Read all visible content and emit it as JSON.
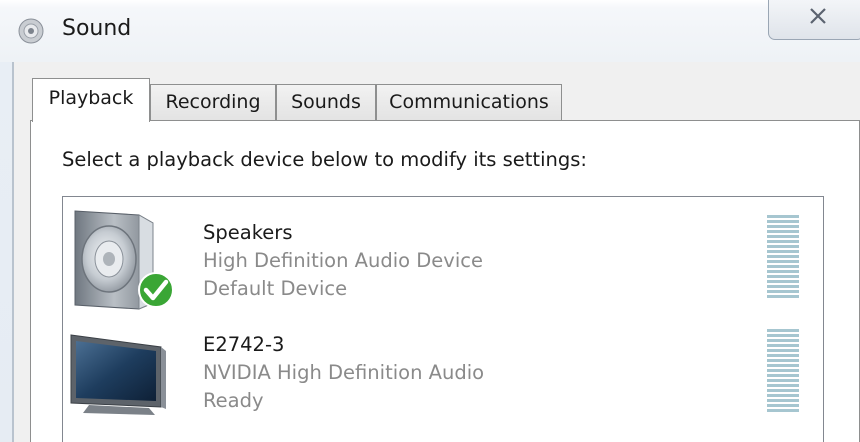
{
  "window": {
    "title": "Sound",
    "icon": "speaker-icon",
    "close_icon": "close-icon"
  },
  "tabs": [
    {
      "label": "Playback",
      "active": true
    },
    {
      "label": "Recording",
      "active": false
    },
    {
      "label": "Sounds",
      "active": false
    },
    {
      "label": "Communications",
      "active": false
    }
  ],
  "playback": {
    "instruction": "Select a playback device below to modify its settings:",
    "devices": [
      {
        "name": "Speakers",
        "description": "High Definition Audio Device",
        "status": "Default Device",
        "icon": "speakers-icon",
        "badge": "default-check-icon"
      },
      {
        "name": "E2742-3",
        "description": "NVIDIA High Definition Audio",
        "status": "Ready",
        "icon": "monitor-icon"
      }
    ]
  },
  "colors": {
    "level_meter": "#a6c6d0",
    "check_badge": "#3aa635"
  }
}
